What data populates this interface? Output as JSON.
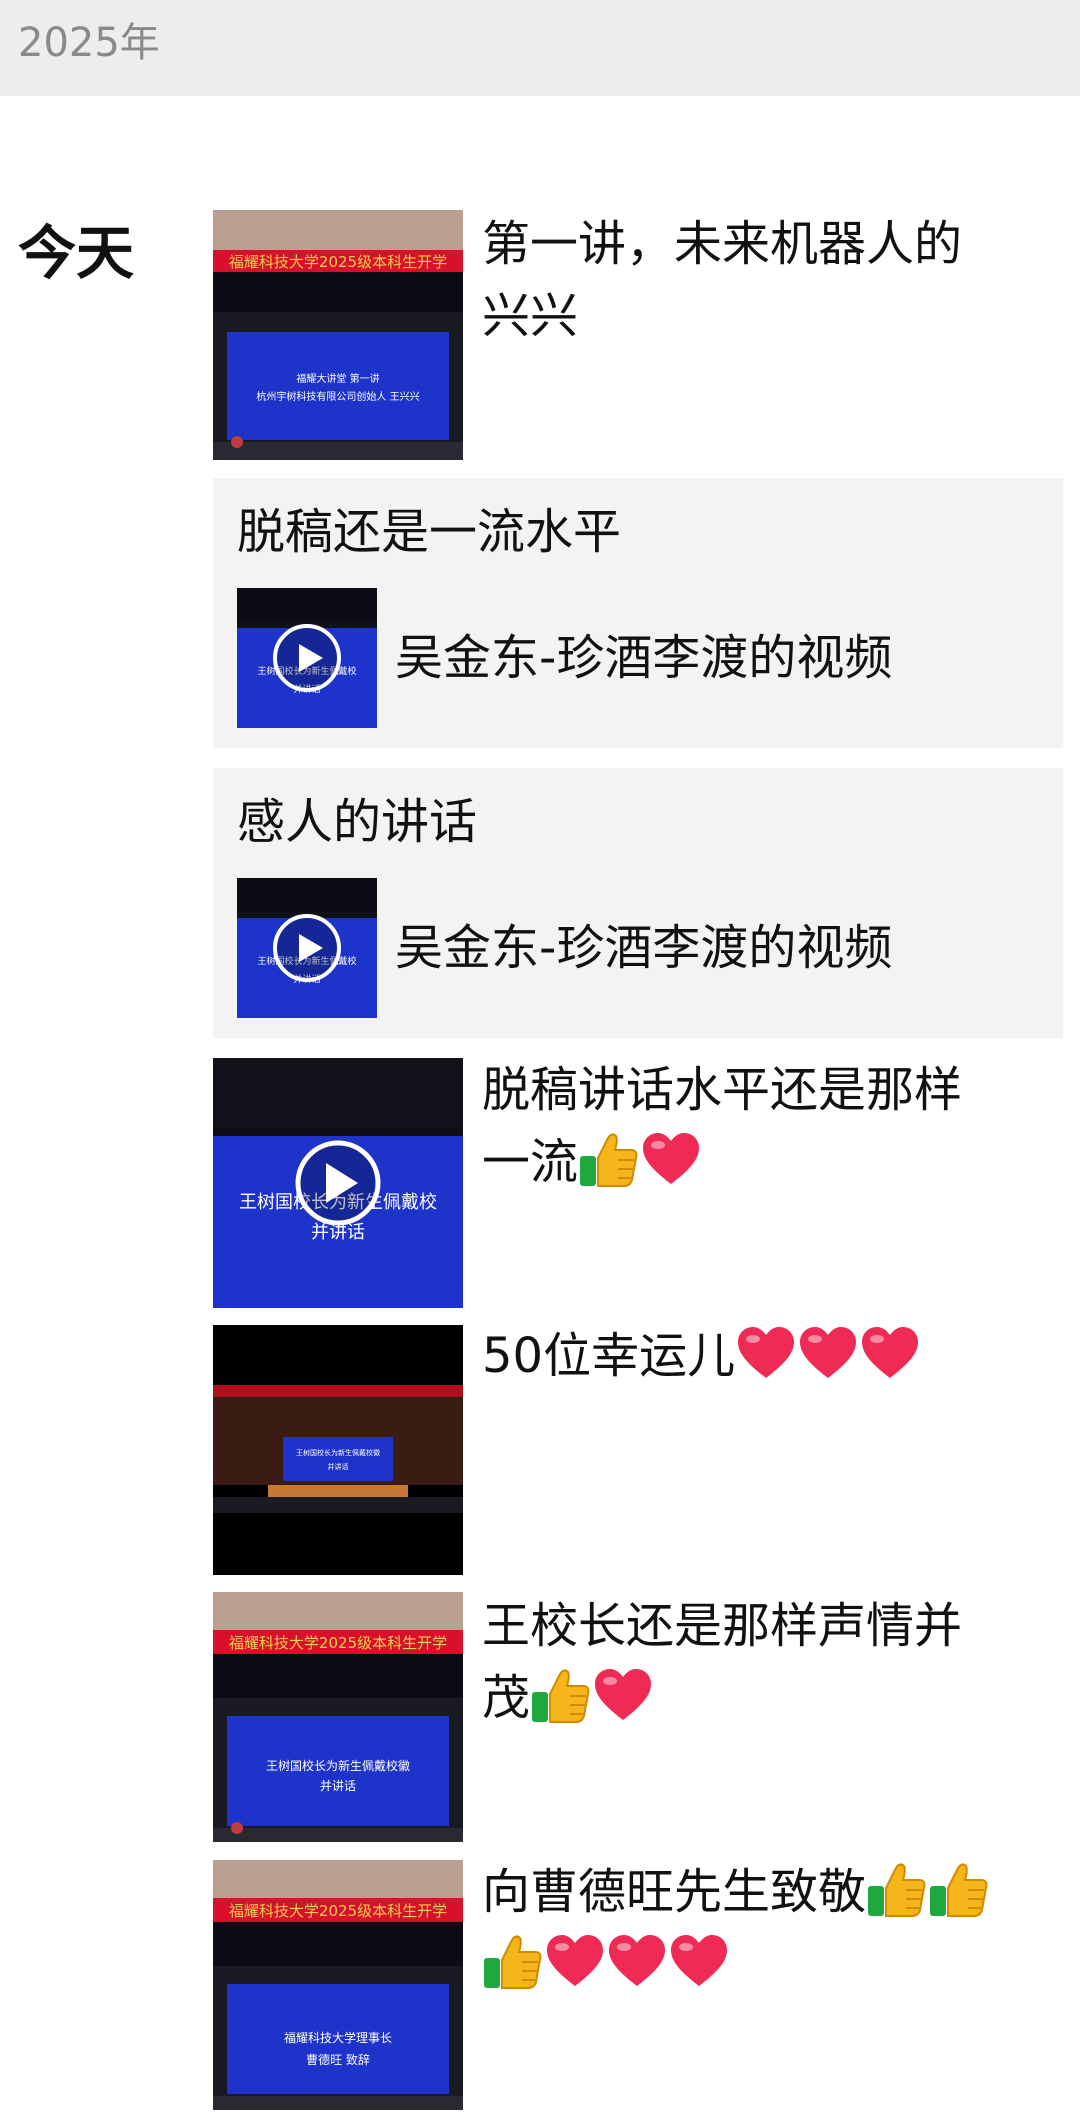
{
  "year": "2025年",
  "day": "今天",
  "posts": [
    {
      "kind": "image",
      "text_lines": [
        "第一讲，未来机器人的",
        "兴兴"
      ],
      "thumb": {
        "banner": "福耀大讲堂 第一讲",
        "subtitle": "杭州宇树科技有限公司创始人 王兴兴"
      }
    },
    {
      "kind": "share",
      "caption": "脱稿还是一流水平",
      "title": "吴金东-珍酒李渡的视频",
      "thumb": {
        "banner": "王树国校长为新生佩戴校",
        "subtitle": "并讲话"
      }
    },
    {
      "kind": "share",
      "caption": "感人的讲话",
      "title": "吴金东-珍酒李渡的视频",
      "thumb": {
        "banner": "王树国校长为新生佩戴校",
        "subtitle": "并讲话"
      }
    },
    {
      "kind": "video",
      "text_lines": [
        "脱稿讲话水平还是那样",
        "一流"
      ],
      "thumb": {
        "banner": "王树国校长为新生佩戴校",
        "subtitle": "并讲话"
      }
    },
    {
      "kind": "video",
      "text_lines": [
        "50位幸运儿"
      ],
      "thumb": {
        "banner": "王树国校长为新生佩戴校徽",
        "subtitle": "并讲话"
      }
    },
    {
      "kind": "image",
      "text_lines": [
        "王校长还是那样声情并",
        "茂"
      ],
      "thumb": {
        "banner": "王树国校长为新生佩戴校徽",
        "subtitle": "并讲话"
      }
    },
    {
      "kind": "image",
      "text_lines": [
        "向曹德旺先生致敬",
        ""
      ],
      "thumb": {
        "banner": "福耀科技大学理事长",
        "subtitle": "曹德旺 致辞"
      }
    }
  ],
  "icons": {
    "play": "play-icon",
    "thumbs": "thumbs-up-emoji",
    "heart": "heart-emoji"
  },
  "colors": {
    "header_bg": "#ededed",
    "share_bg": "#f3f3f3",
    "screen_blue": "#1d33c9",
    "banner_red": "#d8102b",
    "heart": "#ee2a55",
    "thumb_yellow": "#f5b51b",
    "thumb_green": "#1fa83e"
  }
}
